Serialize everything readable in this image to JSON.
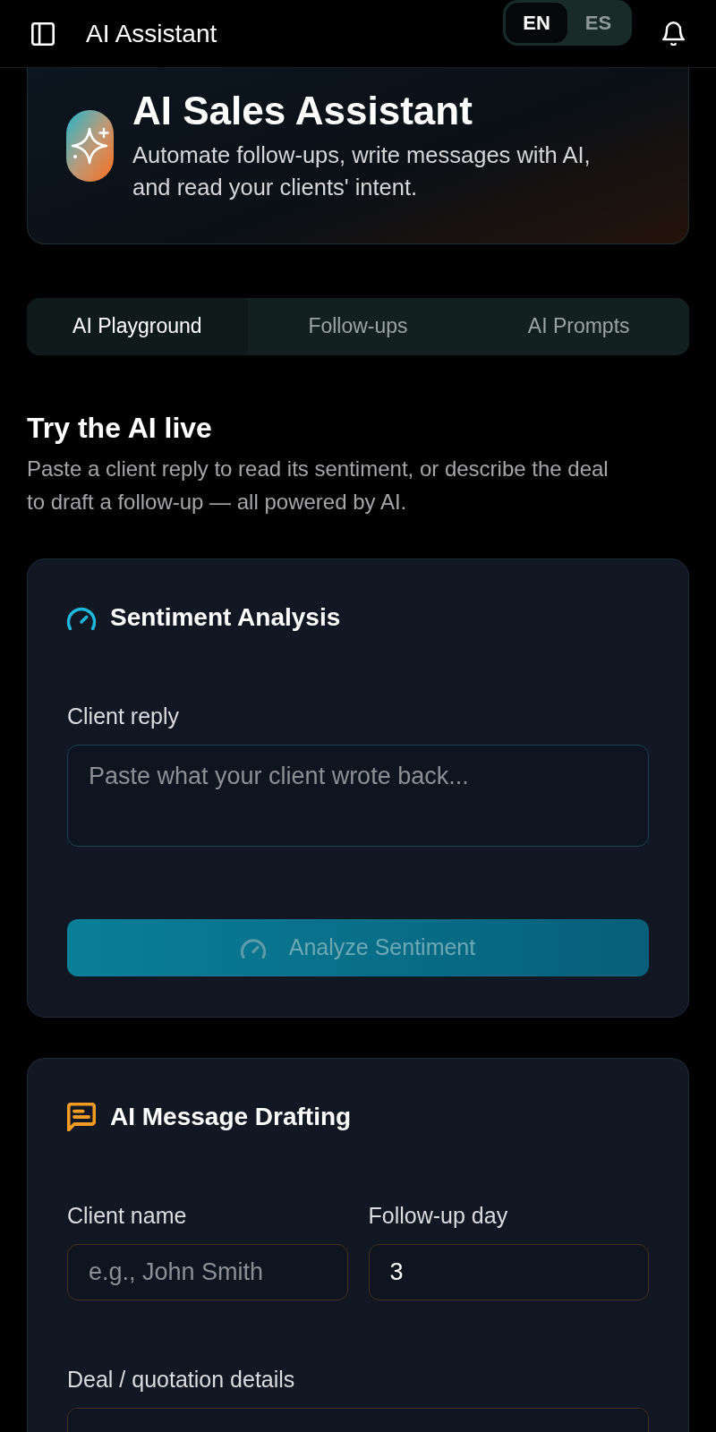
{
  "top_bar": {
    "title": "AI Assistant",
    "languages": [
      {
        "label": "EN",
        "selected": true
      },
      {
        "label": "ES",
        "selected": false
      }
    ]
  },
  "hero": {
    "title": "AI Sales Assistant",
    "subtitle": "Automate follow-ups, write messages with AI, and read your clients' intent."
  },
  "tabs": [
    {
      "label": "AI Playground",
      "selected": true
    },
    {
      "label": "Follow-ups",
      "selected": false
    },
    {
      "label": "AI Prompts",
      "selected": false
    }
  ],
  "section": {
    "title": "Try the AI live",
    "description": "Paste a client reply to read its sentiment, or describe the deal to draft a follow-up — all powered by AI."
  },
  "cards": [
    {
      "kind": "sentiment",
      "title": "Sentiment Analysis",
      "color": "#1fb6dc",
      "rows": [
        {
          "fields": [
            {
              "kind": "textarea",
              "label": "Client reply",
              "placeholder": "Paste what your client wrote back..."
            }
          ]
        }
      ],
      "button": {
        "label": "Analyze Sentiment",
        "disabled": true
      }
    },
    {
      "kind": "drafting",
      "title": "AI Message Drafting",
      "color": "#f59a23",
      "rows": [
        {
          "fields": [
            {
              "kind": "input",
              "label": "Client name",
              "placeholder": "e.g., John Smith"
            },
            {
              "kind": "input",
              "label": "Follow-up day",
              "value": "3"
            }
          ]
        },
        {
          "fields": [
            {
              "kind": "textarea",
              "label": "Deal / quotation details"
            }
          ]
        }
      ]
    }
  ]
}
